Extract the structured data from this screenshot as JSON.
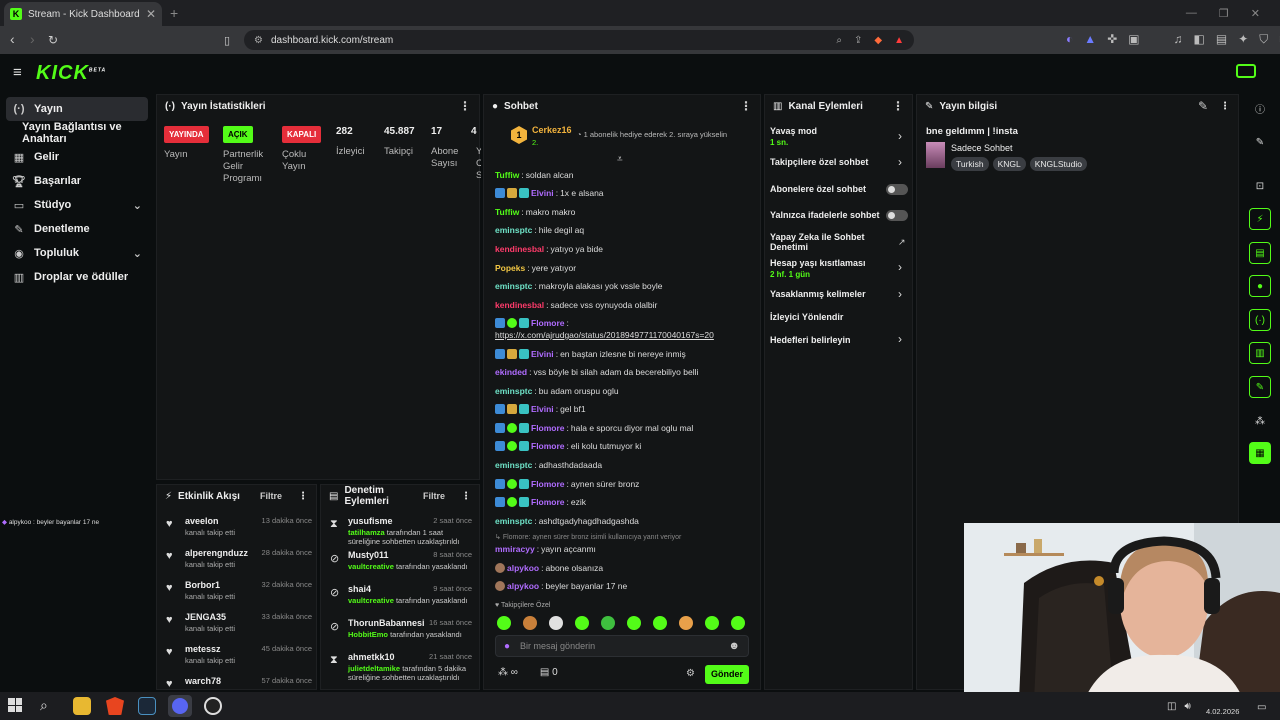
{
  "browser": {
    "tab_title": "Stream - Kick Dashboard",
    "tab_close": "✕",
    "new_tab": "+",
    "url": "dashboard.kick.com/stream"
  },
  "kick": {
    "logo": "KICK",
    "logo_sup": "BETA"
  },
  "sidebar": {
    "items": [
      {
        "label": "Yayın",
        "icon": "broadcast-icon"
      },
      {
        "label": "Yayın Bağlantısı ve Anahtarı"
      },
      {
        "label": "Gelir",
        "icon": "revenue-icon"
      },
      {
        "label": "Başarılar",
        "icon": "trophy-icon"
      },
      {
        "label": "Stüdyo",
        "icon": "studio-icon"
      },
      {
        "label": "Denetleme",
        "icon": "wrench-icon"
      },
      {
        "label": "Topluluk",
        "icon": "community-icon"
      },
      {
        "label": "Droplar ve ödüller",
        "icon": "gift-icon"
      }
    ]
  },
  "overlay_chat": "alpykoo : beyler bayanlar 17 ne",
  "stats": {
    "title": "Yayın İstatistikleri",
    "badges": [
      {
        "label": "YAYINDA",
        "caption": "Yayın"
      },
      {
        "label": "AÇIK",
        "caption": "Partnerlik Gelir Programı"
      },
      {
        "label": "KAPALI",
        "caption": "Çoklu Yayın"
      }
    ],
    "numbers": [
      {
        "value": "282",
        "caption": "İzleyici"
      },
      {
        "value": "45.887",
        "caption": "Takipçi"
      },
      {
        "value": "17",
        "caption": "Abone Sayısı"
      },
      {
        "value": "4",
        "caption": "Y C S"
      }
    ],
    "colors": {
      "live": "#e52e3a",
      "on": "#53fc18",
      "off": "#e52e3a"
    }
  },
  "events": {
    "title": "Etkinlik Akışı",
    "filter": "Filtre",
    "items": [
      {
        "name": "aveelon",
        "time": "13 dakika önce",
        "desc": "kanalı takip etti"
      },
      {
        "name": "alperengnduzz",
        "time": "28 dakika önce",
        "desc": "kanalı takip etti"
      },
      {
        "name": "Borbor1",
        "time": "32 dakika önce",
        "desc": "kanalı takip etti"
      },
      {
        "name": "JENGA35",
        "time": "33 dakika önce",
        "desc": "kanalı takip etti"
      },
      {
        "name": "metessz",
        "time": "45 dakika önce",
        "desc": "kanalı takip etti"
      },
      {
        "name": "warch78",
        "time": "57 dakika önce",
        "desc": ""
      }
    ]
  },
  "moderation": {
    "title": "Denetim Eylemleri",
    "filter": "Filtre",
    "items": [
      {
        "name": "yusufisme",
        "time": "2 saat önce",
        "mod": "tatilhamza",
        "text": " tarafından 1 saat süreliğine sohbetten uzaklaştırıldı",
        "icon": "hourglass-icon"
      },
      {
        "name": "Musty011",
        "time": "8 saat önce",
        "mod": "vaultcreative",
        "text": " tarafından yasaklandı",
        "icon": "ban-icon"
      },
      {
        "name": "shai4",
        "time": "9 saat önce",
        "mod": "vaultcreative",
        "text": " tarafından yasaklandı",
        "icon": "ban-icon"
      },
      {
        "name": "ThorunBabannesi",
        "time": "16 saat önce",
        "mod": "HobbitEmo",
        "text": " tarafından yasaklandı",
        "icon": "ban-icon"
      },
      {
        "name": "ahmetkk10",
        "time": "21 saat önce",
        "mod": "julietdeltamike",
        "text": " tarafından 5 dakika süreliğine sohbetten uzaklaştırıldı",
        "icon": "hourglass-icon"
      }
    ]
  },
  "chat": {
    "title": "Sohbet",
    "pinned_user": "Cerkez16",
    "pinned_rank": "1",
    "pinned_sub": "2.",
    "pinned_text": "1 abonelik hediye ederek 2. sıraya yükselin",
    "messages": [
      {
        "user": "Tuffiw",
        "color": "#53fc18",
        "text": "soldan alcan",
        "badges": 0
      },
      {
        "user": "Elvini",
        "color": "#b06cff",
        "text": "1x e alsana",
        "badges": 3
      },
      {
        "user": "Tuffiw",
        "color": "#53fc18",
        "text": "makro makro",
        "badges": 0
      },
      {
        "user": "eminsptc",
        "color": "#6fe3c8",
        "text": "hile degil aq",
        "badges": 0
      },
      {
        "user": "kendinesbal",
        "color": "#ff3b6b",
        "text": "yatıyo ya bide",
        "badges": 0
      },
      {
        "user": "Popeks",
        "color": "#f2c744",
        "text": "yere yatıyor",
        "badges": 0
      },
      {
        "user": "eminsptc",
        "color": "#6fe3c8",
        "text": "makroyla alakası yok vssle boyle",
        "badges": 0
      },
      {
        "user": "kendinesbal",
        "color": "#ff3b6b",
        "text": "sadece vss oynuyoda olalbir",
        "badges": 0
      },
      {
        "user": "Flomore",
        "color": "#b06cff",
        "text": "",
        "badges": 3
      },
      {
        "user": "",
        "color": "#ddd",
        "text": "https://x.com/ajrudgao/status/2018949771170040167s=20",
        "badges": 0
      },
      {
        "user": "Elvini",
        "color": "#b06cff",
        "text": "en baştan izlesne bi nereye inmiş",
        "badges": 3
      },
      {
        "user": "ekinded",
        "color": "#b06cff",
        "text": "vss böyle bi silah adam da becerebiliyo belli",
        "badges": 0
      },
      {
        "user": "eminsptc",
        "color": "#6fe3c8",
        "text": "bu adam oruspu oglu",
        "badges": 0
      },
      {
        "user": "Elvini",
        "color": "#b06cff",
        "text": "gel bf1",
        "badges": 3
      },
      {
        "user": "Flomore",
        "color": "#b06cff",
        "text": "hala e sporcu diyor mal oglu mal",
        "badges": 3
      },
      {
        "user": "Flomore",
        "color": "#b06cff",
        "text": "eli kolu tutmuyor ki",
        "badges": 3
      },
      {
        "user": "eminsptc",
        "color": "#6fe3c8",
        "text": "adhasthdadaada",
        "badges": 0
      },
      {
        "user": "Flomore",
        "color": "#b06cff",
        "text": "aynen sürer bronz",
        "badges": 3
      },
      {
        "user": "Flomore",
        "color": "#b06cff",
        "text": "ezik",
        "badges": 3
      },
      {
        "user": "eminsptc",
        "color": "#6fe3c8",
        "text": "ashdtgadyhagdhadgashda",
        "badges": 0
      }
    ],
    "reply_hint": "Flomore: aynen sürer bronz isimli kullanıcıya yanıt veriyor",
    "tail": [
      {
        "user": "mmiracyy",
        "color": "#b06cff",
        "text": "yayın açcanmı"
      },
      {
        "user": "alpykoo",
        "color": "#b06cff",
        "text": "abone olsanıza"
      },
      {
        "user": "alpykoo",
        "color": "#b06cff",
        "text": "beyler bayanlar 17 ne"
      }
    ],
    "followers_only": "Takipçilere Özel",
    "input_placeholder": "Bir mesaj gönderin",
    "count_inf": "∞",
    "count_zero": "0",
    "send": "Gönder"
  },
  "channel_actions": {
    "title": "Kanal Eylemleri",
    "items": [
      {
        "label": "Yavaş mod",
        "sub": "1 sn."
      },
      {
        "label": "Takipçilere özel sohbet"
      },
      {
        "label": "Abonelere özel sohbet"
      },
      {
        "label": "Yalnızca ifadelerle sohbet"
      },
      {
        "label": "Yapay Zeka ile Sohbet Denetimi"
      },
      {
        "label": "Hesap yaşı kısıtlaması",
        "sub": "2 hf. 1 gün"
      },
      {
        "label": "Yasaklanmış kelimeler"
      },
      {
        "label": "İzleyici Yönlendir"
      },
      {
        "label": "Hedefleri belirleyin"
      }
    ]
  },
  "stream_info": {
    "title": "Yayın bilgisi",
    "stream_title": "bne geldımm | !insta",
    "category": "Sadece Sohbet",
    "tags": [
      "Turkish",
      "KNGL",
      "KNGLStudio"
    ]
  },
  "taskbar": {
    "date": "4.02.2026"
  }
}
